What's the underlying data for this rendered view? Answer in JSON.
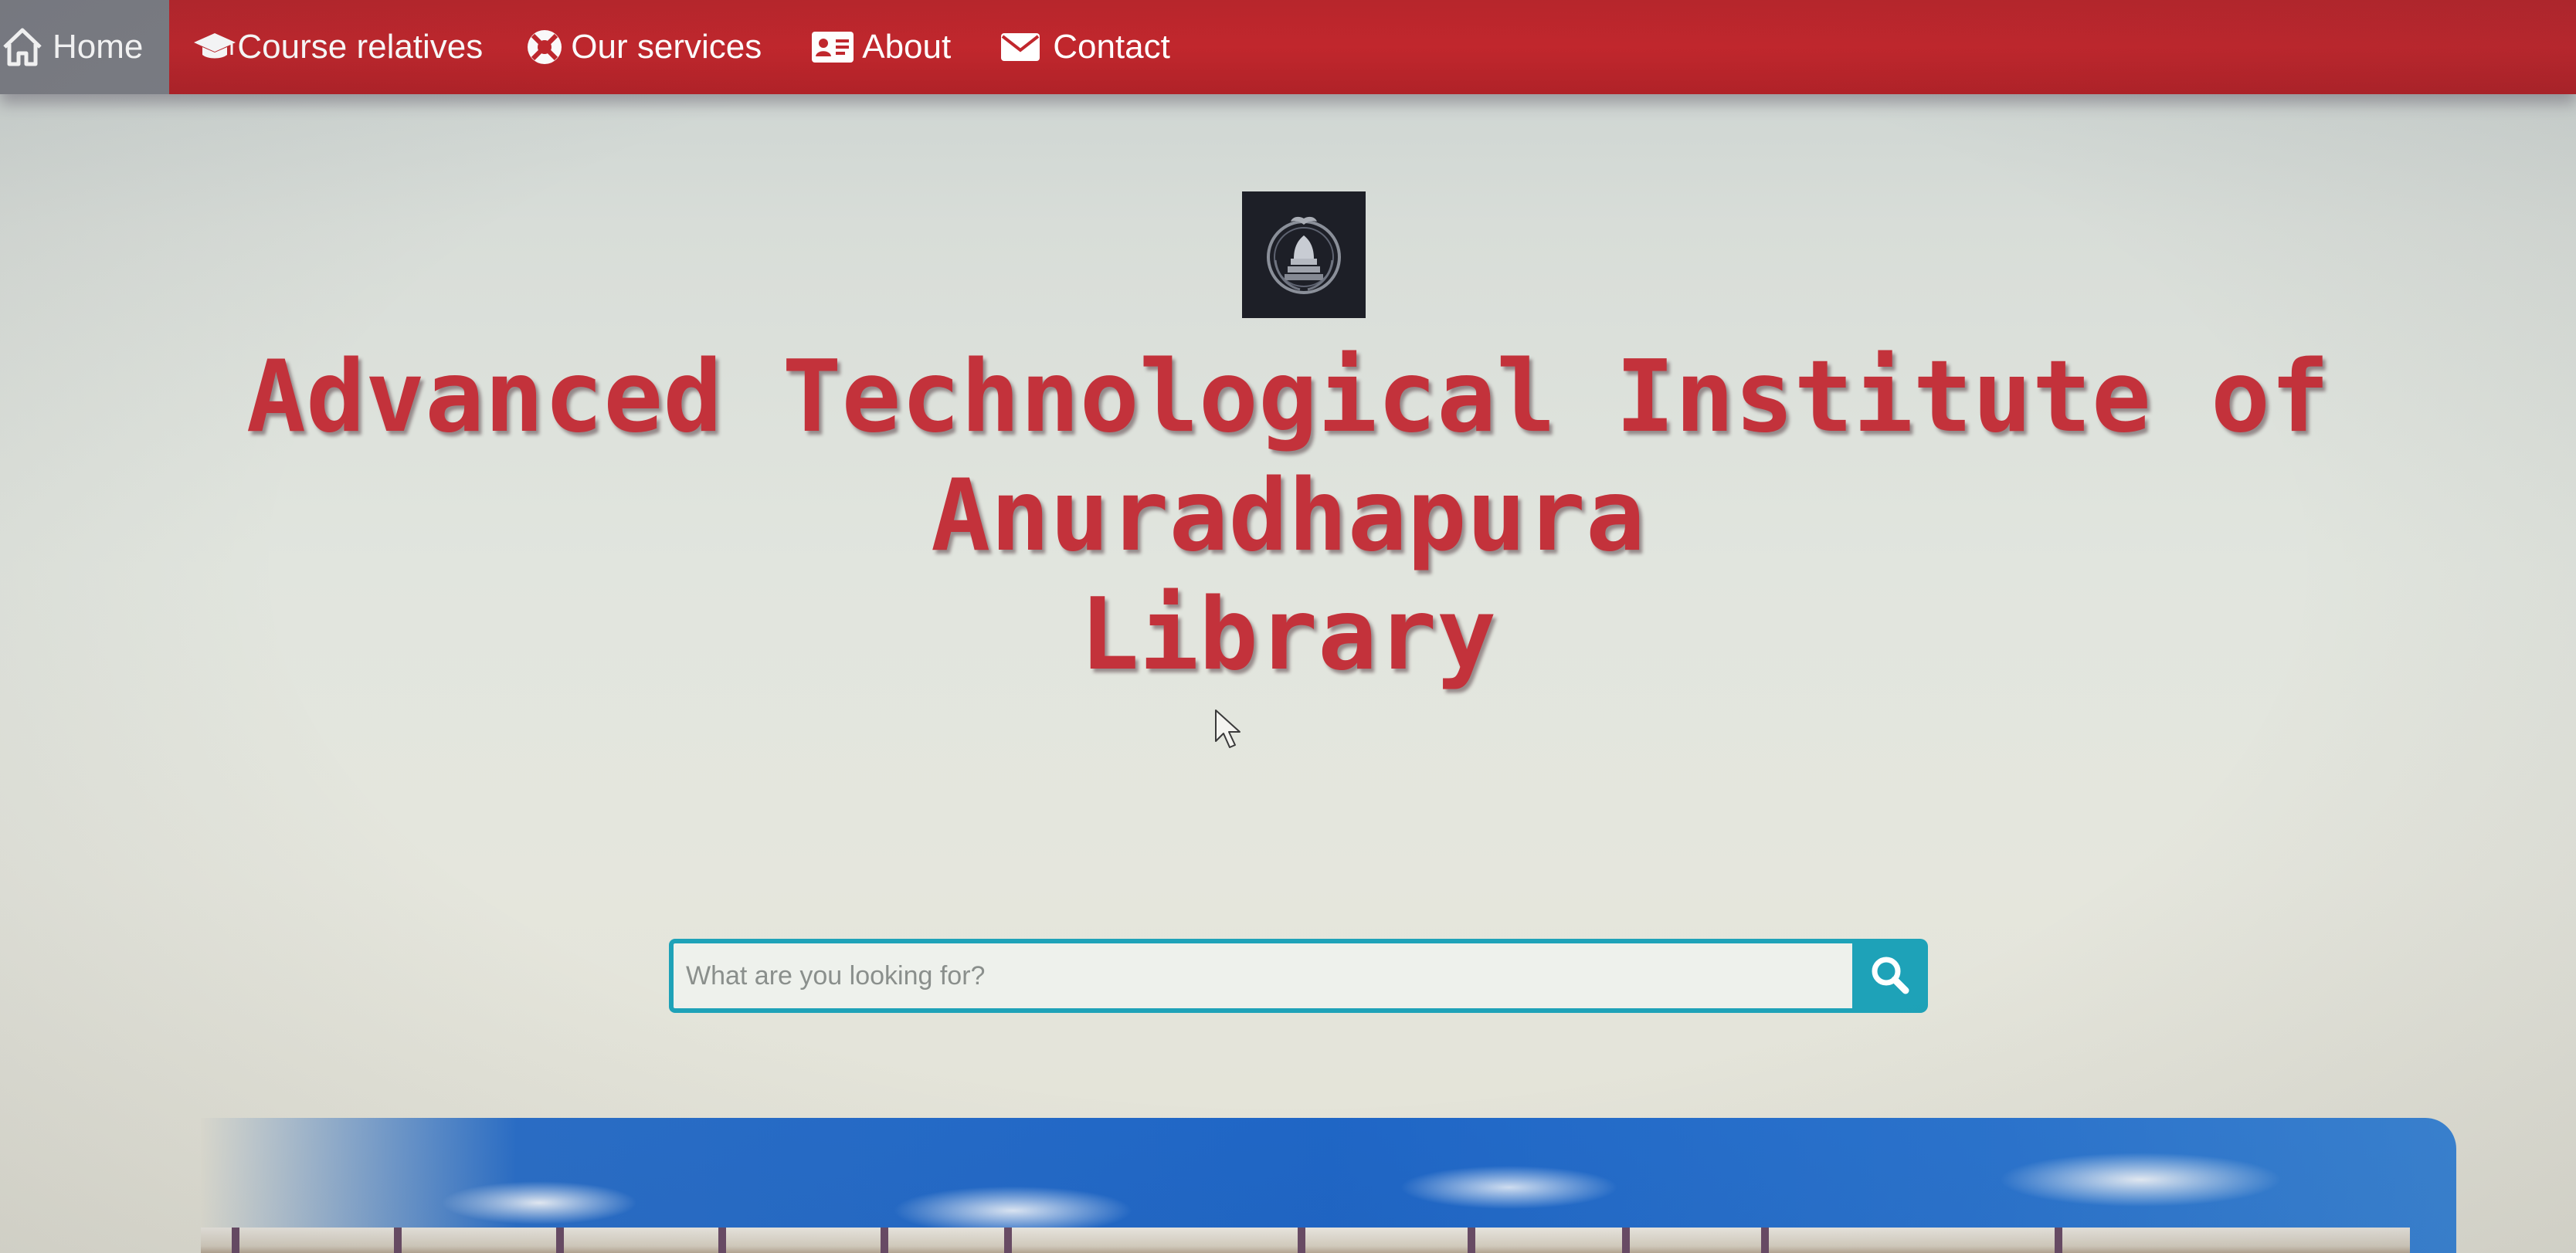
{
  "nav": {
    "items": [
      {
        "label": "Home",
        "icon": "home-icon"
      },
      {
        "label": "Course relatives",
        "icon": "graduation-cap-icon"
      },
      {
        "label": "Our services",
        "icon": "life-ring-icon"
      },
      {
        "label": "About",
        "icon": "id-card-icon"
      },
      {
        "label": "Contact",
        "icon": "envelope-icon"
      }
    ],
    "active": "Home"
  },
  "header": {
    "title_line1": "Advanced Technological Institute of",
    "title_line2": "Anuradhapura",
    "title_line3": "Library"
  },
  "search": {
    "placeholder": "What are you looking for?",
    "value": ""
  },
  "colors": {
    "navbar": "#c1272d",
    "nav_active": "#7d7f86",
    "title": "#c3323b",
    "search_accent": "#1ea2b8"
  }
}
